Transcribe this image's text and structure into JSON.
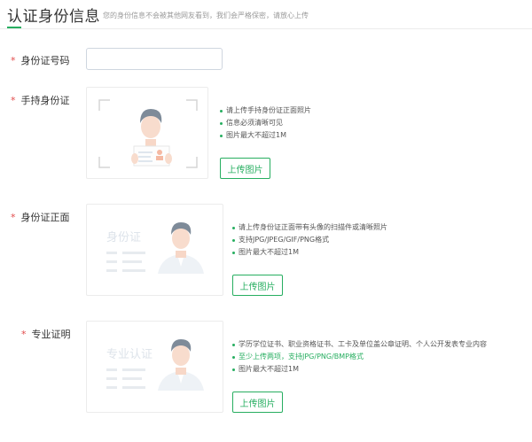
{
  "header": {
    "title": "认证身份信息",
    "subtitle": "您的身份信息不会被其他网友看到，我们会严格保密，请放心上传"
  },
  "required_mark": "*",
  "colors": {
    "accent": "#27ae60",
    "required": "#e24b4b"
  },
  "fields": {
    "id_number": {
      "label": "身份证号码",
      "value": "",
      "placeholder": ""
    },
    "hand_held": {
      "label": "手持身份证",
      "tips": [
        "请上传手持身份证正面照片",
        "信息必须清晰可见",
        "图片最大不超过1M"
      ],
      "button_label": "上传图片"
    },
    "id_front": {
      "label": "身份证正面",
      "card_text": "身份证",
      "tips": [
        "请上传身份证正面带有头像的扫描件或清晰照片",
        "支持JPG/JPEG/GIF/PNG格式",
        "图片最大不超过1M"
      ],
      "button_label": "上传图片"
    },
    "professional": {
      "label": "专业证明",
      "card_text": "专业认证",
      "tips": [
        "学历学位证书、职业资格证书、工卡及单位盖公章证明、个人公开发表专业内容",
        "至少上传两项，支持JPG/PNG/BMP格式",
        "图片最大不超过1M"
      ],
      "button_label": "上传图片"
    }
  }
}
